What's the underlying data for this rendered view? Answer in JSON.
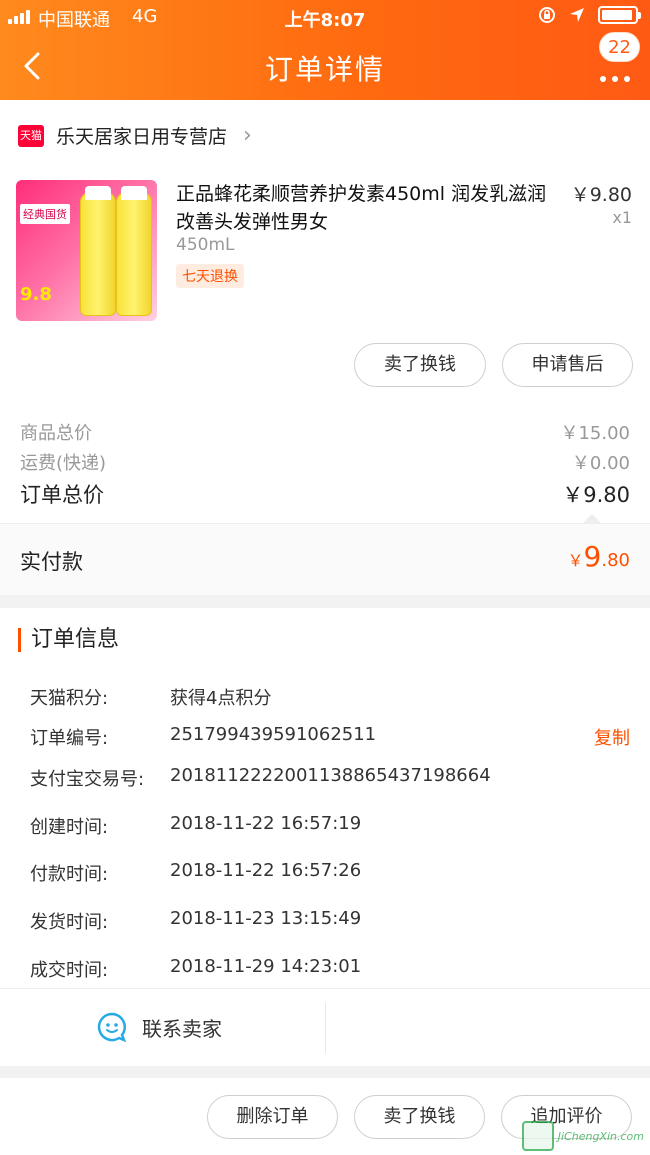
{
  "status_bar": {
    "carrier": "中国联通",
    "network": "4G",
    "time": "上午8:07"
  },
  "nav": {
    "title": "订单详情",
    "badge_count": "22"
  },
  "shop": {
    "logo_text": "天猫",
    "name": "乐天居家日用专营店"
  },
  "product": {
    "name": "正品蜂花柔顺营养护发素450ml 润发乳滋润改善头发弹性男女",
    "price": "￥9.80",
    "quantity": "x1",
    "spec": "450mL",
    "tag": "七天退换",
    "image_label_top": "经典国货",
    "image_label_bottom": "9.8"
  },
  "item_actions": {
    "sell_label": "卖了换钱",
    "after_sale_label": "申请售后"
  },
  "totals": {
    "goods_label": "商品总价",
    "goods_value": "￥15.00",
    "shipping_label": "运费(快递)",
    "shipping_value": "￥0.00",
    "order_total_label": "订单总价",
    "order_total_value": "￥9.80",
    "paid_label": "实付款",
    "paid_currency": "￥",
    "paid_integer": "9",
    "paid_decimal": ".80"
  },
  "order_info": {
    "title": "订单信息",
    "rows": [
      {
        "label": "天猫积分:",
        "value": "获得4点积分"
      },
      {
        "label": "订单编号:",
        "value": "251799439591062511",
        "action": "复制"
      },
      {
        "label": "支付宝交易号:",
        "value": "2018112222001138865437198664"
      },
      {
        "label": "创建时间:",
        "value": "2018-11-22 16:57:19"
      },
      {
        "label": "付款时间:",
        "value": "2018-11-22 16:57:26"
      },
      {
        "label": "发货时间:",
        "value": "2018-11-23 13:15:49"
      },
      {
        "label": "成交时间:",
        "value": "2018-11-29 14:23:01"
      }
    ]
  },
  "contact": {
    "label": "联系卖家"
  },
  "bottom_actions": {
    "delete_label": "删除订单",
    "sell_label": "卖了换钱",
    "review_label": "追加评价"
  },
  "watermark": {
    "text": "JiChengXin.com"
  },
  "colors": {
    "header_start": "#ff8a1d",
    "header_end": "#ff5a14",
    "accent": "#ff5000",
    "tmall_red": "#ff0036"
  }
}
